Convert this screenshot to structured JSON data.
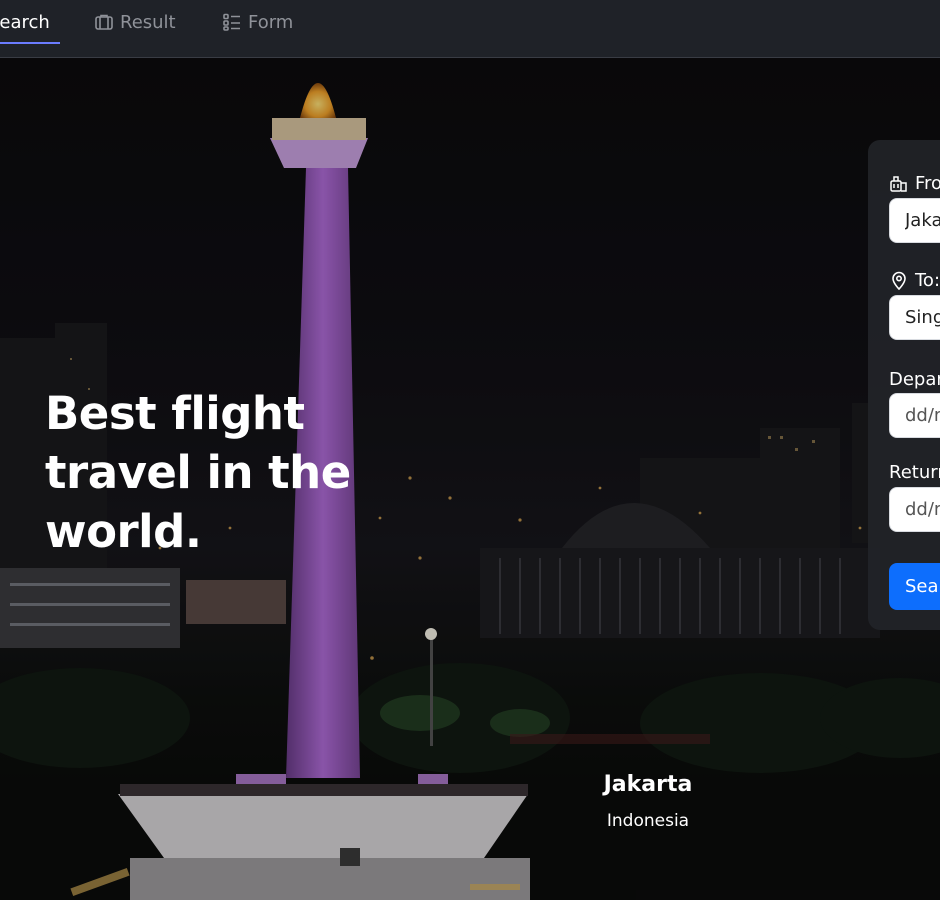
{
  "nav": {
    "tabs": [
      {
        "label": "Search",
        "icon": "search-icon",
        "active": true
      },
      {
        "label": "Result",
        "icon": "suitcase-icon",
        "active": false
      },
      {
        "label": "Form",
        "icon": "form-list-icon",
        "active": false
      }
    ]
  },
  "hero": {
    "headline": "Best flight travel in the world.",
    "city": "Jakarta",
    "country": "Indonesia"
  },
  "form": {
    "from_label": "From:",
    "from_value": "Jakarta",
    "to_label": "To:",
    "to_value": "Singapore",
    "departure_label": "Departure:",
    "departure_placeholder": "dd/mm/yyyy",
    "return_label": "Return:",
    "return_placeholder": "dd/mm/yyyy",
    "search_label": "Search"
  },
  "colors": {
    "nav_bg": "#1f2228",
    "active_underline": "#6b7cff",
    "button": "#0d6efd",
    "monument_light": "#b06cd8"
  }
}
